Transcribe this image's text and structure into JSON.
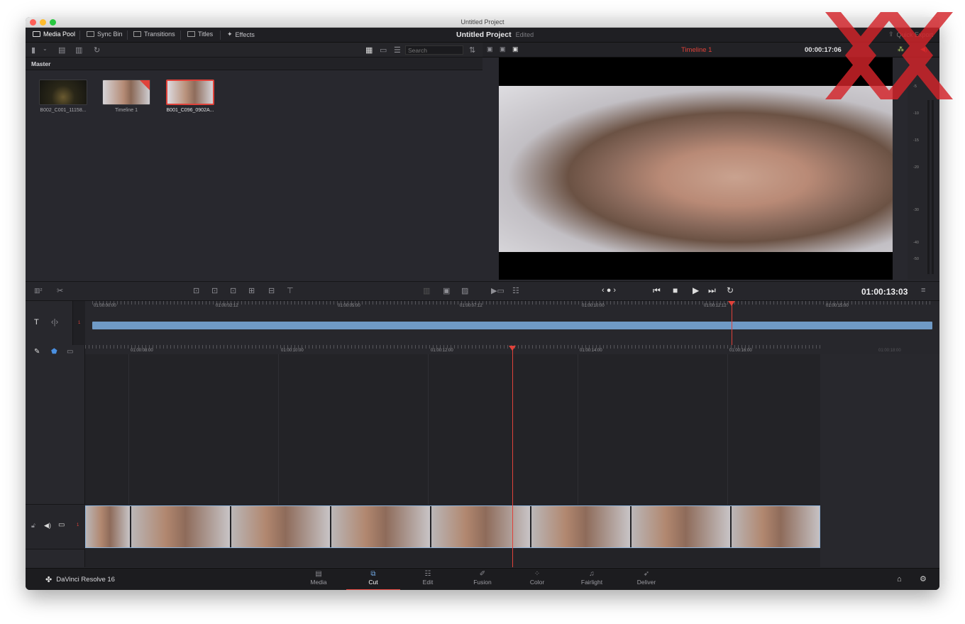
{
  "window": {
    "title": "Untitled Project"
  },
  "toolbar": {
    "media_pool": "Media Pool",
    "sync_bin": "Sync Bin",
    "transitions": "Transitions",
    "titles": "Titles",
    "effects": "Effects",
    "project_name": "Untitled Project",
    "project_status": "Edited",
    "quick_export": "Quick Export"
  },
  "media_pool": {
    "search_placeholder": "Search",
    "bin_name": "Master",
    "clips": [
      {
        "name": "B002_C001_11158..."
      },
      {
        "name": "Timeline 1"
      },
      {
        "name": "B001_C096_0902A..."
      }
    ]
  },
  "viewer": {
    "timeline_name": "Timeline 1",
    "timecode": "00:00:17:06",
    "current_timecode": "01:00:13:03",
    "meter_labels": [
      "-5",
      "-10",
      "-15",
      "-20",
      "-30",
      "-40",
      "-50"
    ]
  },
  "upper_timeline": {
    "marks": [
      "01:00:00:00",
      "01:00:02:12",
      "01:00:05:00",
      "01:00:07:12",
      "01:00:10:00",
      "01:00:12:12",
      "01:00:15:00"
    ],
    "track_number": "1"
  },
  "lower_timeline": {
    "marks": [
      "01:00:08:00",
      "01:00:10:00",
      "01:00:12:00",
      "01:00:14:00",
      "01:00:16:00",
      "01:00:18:00"
    ],
    "track_number": "1"
  },
  "pages": {
    "brand": "DaVinci Resolve 16",
    "tabs": [
      "Media",
      "Cut",
      "Edit",
      "Fusion",
      "Color",
      "Fairlight",
      "Deliver"
    ],
    "active": "Cut"
  },
  "colors": {
    "accent": "#e0423a",
    "clip_blue": "#6f9ac6",
    "active_tab": "#6fa6e0"
  }
}
